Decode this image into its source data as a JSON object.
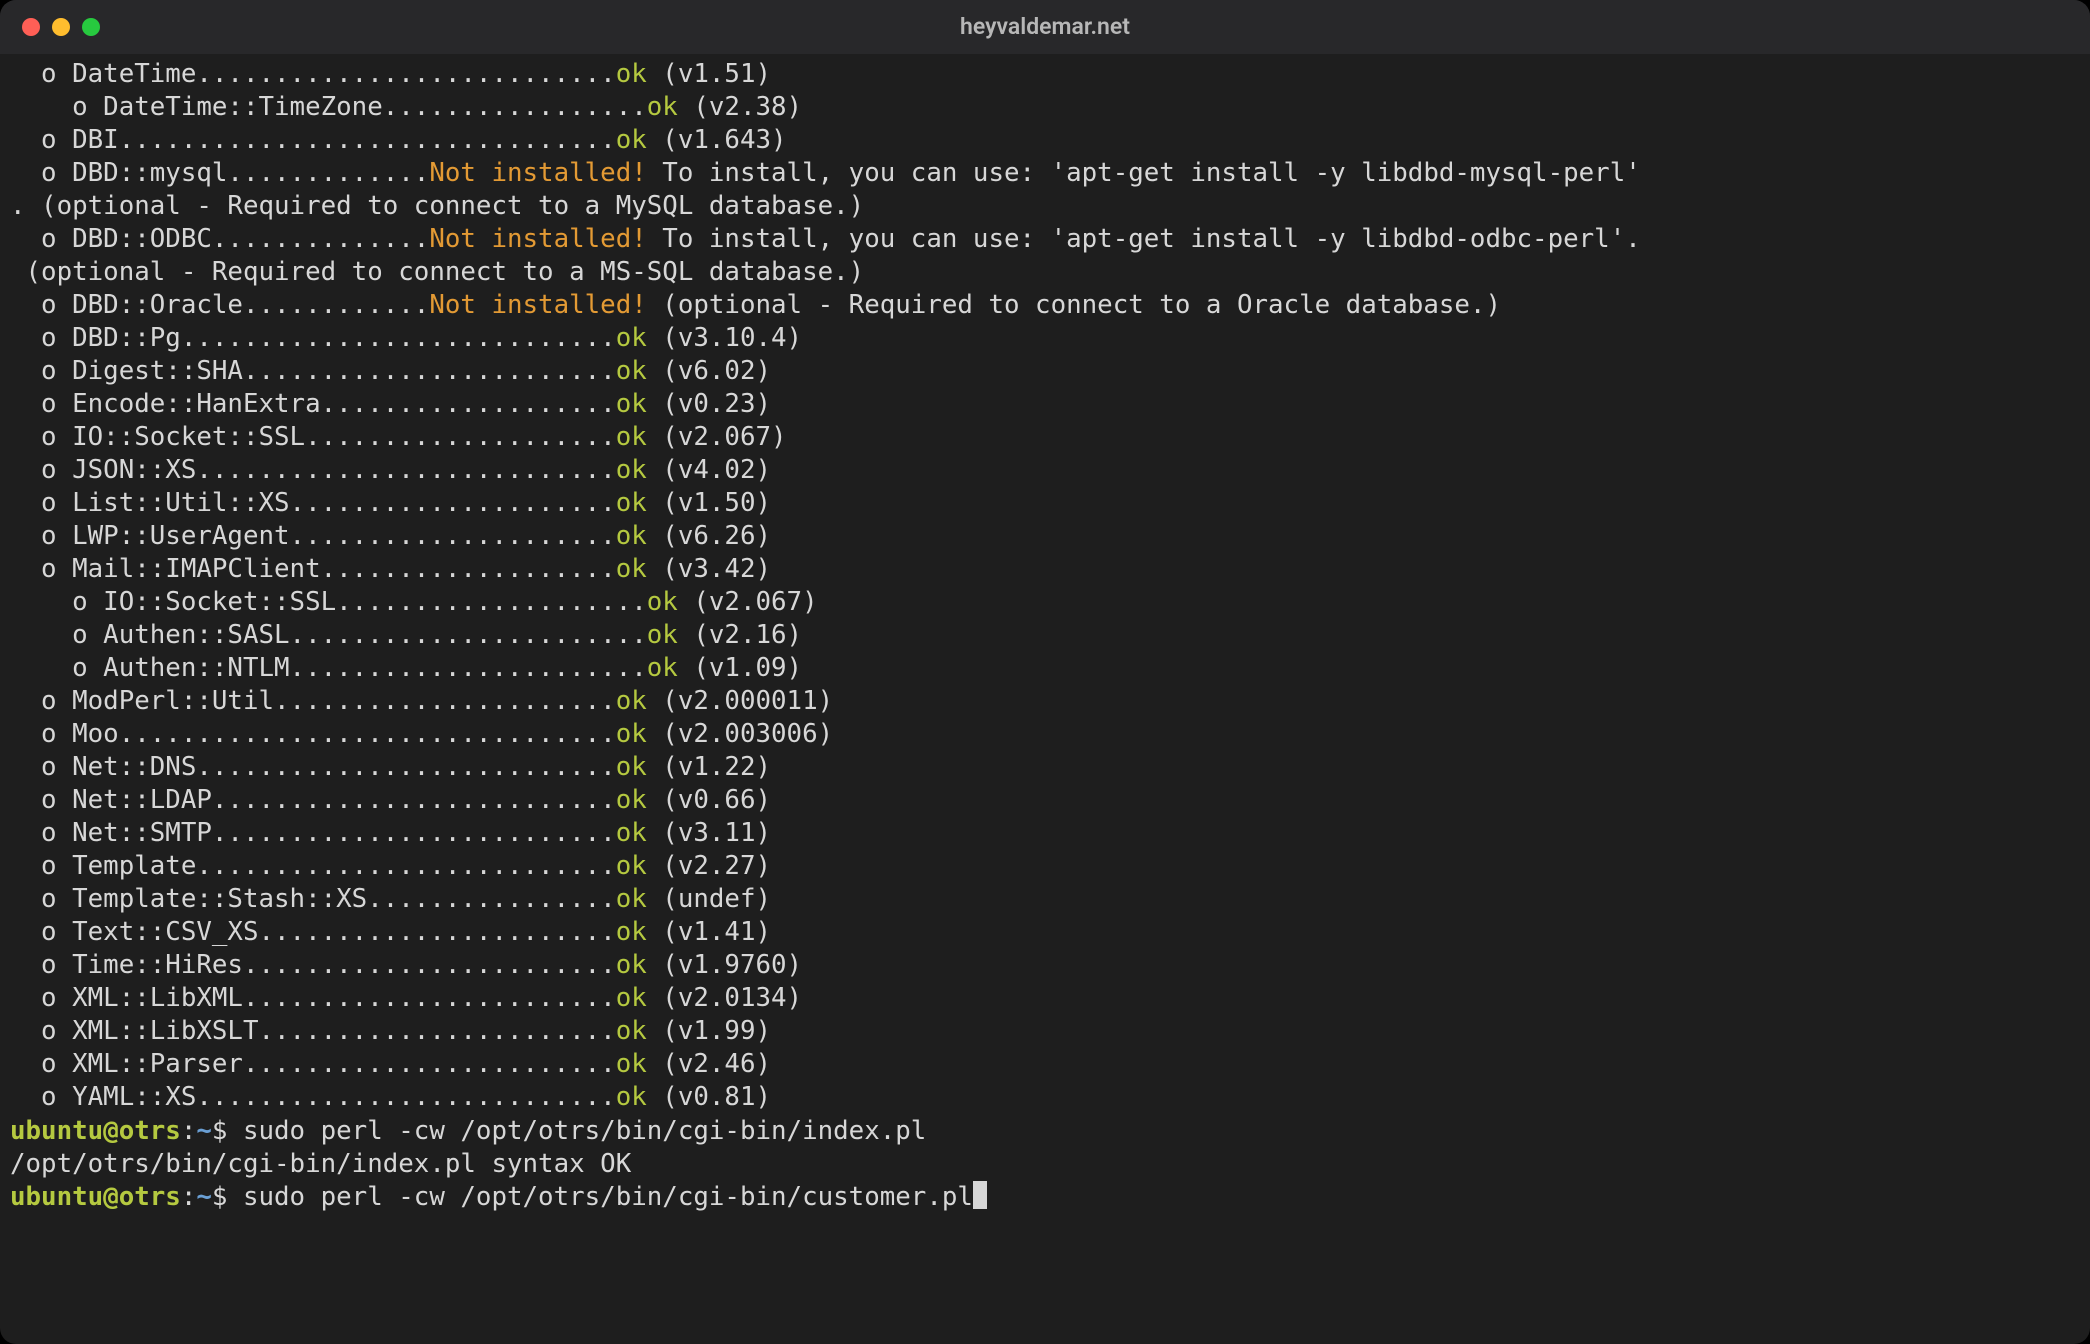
{
  "window": {
    "title": "heyvaldemar.net"
  },
  "colors": {
    "bg": "#1e1e1e",
    "titlebar": "#28282a",
    "text": "#d7d7d7",
    "ok": "#b5c940",
    "warn": "#e39a34",
    "prompt_user": "#b5c940",
    "prompt_path": "#6a9fd4",
    "close": "#ff5f56",
    "minimize": "#ffbd2e",
    "zoom": "#27c93f"
  },
  "layout": {
    "bulletCharWidth": 41,
    "subBulletCharWidth": 43
  },
  "output": {
    "lines": [
      {
        "type": "mod",
        "indent": 1,
        "name": "DateTime",
        "status": "ok",
        "version": "(v1.51)"
      },
      {
        "type": "mod",
        "indent": 2,
        "name": "DateTime::TimeZone",
        "status": "ok",
        "version": "(v2.38)"
      },
      {
        "type": "mod",
        "indent": 1,
        "name": "DBI",
        "status": "ok",
        "version": "(v1.643)"
      },
      {
        "type": "mod",
        "indent": 1,
        "name": "DBD::mysql",
        "status": "not",
        "tail": "To install, you can use: 'apt-get install -y libdbd-mysql-perl'"
      },
      {
        "type": "wrap",
        "text": ". (optional - Required to connect to a MySQL database.)"
      },
      {
        "type": "mod",
        "indent": 1,
        "name": "DBD::ODBC",
        "status": "not",
        "tail": "To install, you can use: 'apt-get install -y libdbd-odbc-perl'."
      },
      {
        "type": "wrap",
        "text": " (optional - Required to connect to a MS-SQL database.)"
      },
      {
        "type": "mod",
        "indent": 1,
        "name": "DBD::Oracle",
        "status": "not",
        "tail": "(optional - Required to connect to a Oracle database.)"
      },
      {
        "type": "mod",
        "indent": 1,
        "name": "DBD::Pg",
        "status": "ok",
        "version": "(v3.10.4)"
      },
      {
        "type": "mod",
        "indent": 1,
        "name": "Digest::SHA",
        "status": "ok",
        "version": "(v6.02)"
      },
      {
        "type": "mod",
        "indent": 1,
        "name": "Encode::HanExtra",
        "status": "ok",
        "version": "(v0.23)"
      },
      {
        "type": "mod",
        "indent": 1,
        "name": "IO::Socket::SSL",
        "status": "ok",
        "version": "(v2.067)"
      },
      {
        "type": "mod",
        "indent": 1,
        "name": "JSON::XS",
        "status": "ok",
        "version": "(v4.02)"
      },
      {
        "type": "mod",
        "indent": 1,
        "name": "List::Util::XS",
        "status": "ok",
        "version": "(v1.50)"
      },
      {
        "type": "mod",
        "indent": 1,
        "name": "LWP::UserAgent",
        "status": "ok",
        "version": "(v6.26)"
      },
      {
        "type": "mod",
        "indent": 1,
        "name": "Mail::IMAPClient",
        "status": "ok",
        "version": "(v3.42)"
      },
      {
        "type": "mod",
        "indent": 2,
        "name": "IO::Socket::SSL",
        "status": "ok",
        "version": "(v2.067)"
      },
      {
        "type": "mod",
        "indent": 2,
        "name": "Authen::SASL",
        "status": "ok",
        "version": "(v2.16)"
      },
      {
        "type": "mod",
        "indent": 2,
        "name": "Authen::NTLM",
        "status": "ok",
        "version": "(v1.09)"
      },
      {
        "type": "mod",
        "indent": 1,
        "name": "ModPerl::Util",
        "status": "ok",
        "version": "(v2.000011)"
      },
      {
        "type": "mod",
        "indent": 1,
        "name": "Moo",
        "status": "ok",
        "version": "(v2.003006)"
      },
      {
        "type": "mod",
        "indent": 1,
        "name": "Net::DNS",
        "status": "ok",
        "version": "(v1.22)"
      },
      {
        "type": "mod",
        "indent": 1,
        "name": "Net::LDAP",
        "status": "ok",
        "version": "(v0.66)"
      },
      {
        "type": "mod",
        "indent": 1,
        "name": "Net::SMTP",
        "status": "ok",
        "version": "(v3.11)"
      },
      {
        "type": "mod",
        "indent": 1,
        "name": "Template",
        "status": "ok",
        "version": "(v2.27)"
      },
      {
        "type": "mod",
        "indent": 1,
        "name": "Template::Stash::XS",
        "status": "ok",
        "version": "(undef)"
      },
      {
        "type": "mod",
        "indent": 1,
        "name": "Text::CSV_XS",
        "status": "ok",
        "version": "(v1.41)"
      },
      {
        "type": "mod",
        "indent": 1,
        "name": "Time::HiRes",
        "status": "ok",
        "version": "(v1.9760)"
      },
      {
        "type": "mod",
        "indent": 1,
        "name": "XML::LibXML",
        "status": "ok",
        "version": "(v2.0134)"
      },
      {
        "type": "mod",
        "indent": 1,
        "name": "XML::LibXSLT",
        "status": "ok",
        "version": "(v1.99)"
      },
      {
        "type": "mod",
        "indent": 1,
        "name": "XML::Parser",
        "status": "ok",
        "version": "(v2.46)"
      },
      {
        "type": "mod",
        "indent": 1,
        "name": "YAML::XS",
        "status": "ok",
        "version": "(v0.81)"
      }
    ],
    "status_labels": {
      "ok": "ok",
      "not": "Not installed!"
    },
    "history": [
      {
        "prompt": {
          "user": "ubuntu",
          "host": "otrs",
          "path": "~"
        },
        "command": "sudo perl -cw /opt/otrs/bin/cgi-bin/index.pl",
        "result": "/opt/otrs/bin/cgi-bin/index.pl syntax OK"
      }
    ],
    "current": {
      "prompt": {
        "user": "ubuntu",
        "host": "otrs",
        "path": "~"
      },
      "command": "sudo perl -cw /opt/otrs/bin/cgi-bin/customer.pl"
    }
  }
}
